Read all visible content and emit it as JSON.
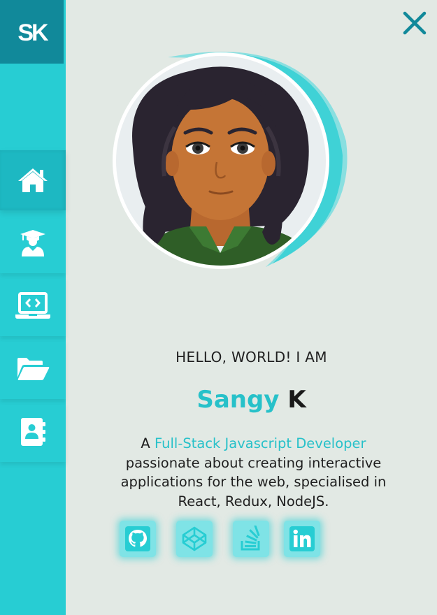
{
  "logo": {
    "text": "SK"
  },
  "nav": {
    "items": [
      {
        "name": "home",
        "icon": "home-icon",
        "active": true
      },
      {
        "name": "education",
        "icon": "graduate-icon",
        "active": false
      },
      {
        "name": "projects",
        "icon": "laptop-code-icon",
        "active": false
      },
      {
        "name": "portfolio",
        "icon": "folder-open-icon",
        "active": false
      },
      {
        "name": "contact",
        "icon": "address-book-icon",
        "active": false
      }
    ]
  },
  "hero": {
    "greeting": "HELLO, WORLD! I AM",
    "first_name": "Sangy",
    "last_name": "K",
    "bio_prefix": "A",
    "role": "Full-Stack Javascript Developer",
    "bio_line2": "passionate about creating interactive",
    "bio_line3": "applications for the web, specialised in",
    "bio_line4": "React, Redux, NodeJS."
  },
  "socials": [
    {
      "icon": "github-icon"
    },
    {
      "icon": "codepen-icon"
    },
    {
      "icon": "stackoverflow-icon"
    },
    {
      "icon": "linkedin-icon"
    }
  ],
  "colors": {
    "accent": "#27cdd3",
    "logo_bg": "#11899a",
    "background": "#e2e9e4",
    "close": "#11899a"
  }
}
